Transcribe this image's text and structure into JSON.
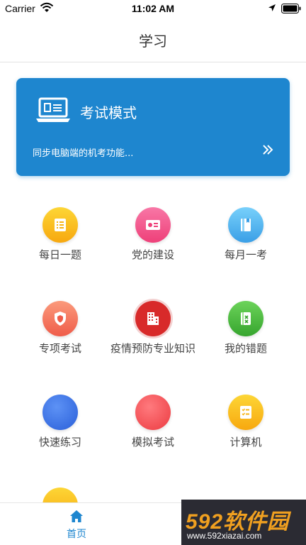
{
  "status_bar": {
    "carrier": "Carrier",
    "time": "11:02 AM"
  },
  "nav": {
    "title": "学习"
  },
  "exam_card": {
    "title": "考试模式",
    "subtitle": "同步电脑端的机考功能...",
    "color": "#1e86cf",
    "icon": "laptop-icon"
  },
  "grid": {
    "items": [
      {
        "label": "每日一题",
        "icon": "list-icon",
        "color": "#f9c21a"
      },
      {
        "label": "党的建设",
        "icon": "party-flag-icon",
        "color": "#f45b8e"
      },
      {
        "label": "每月一考",
        "icon": "book-icon",
        "color": "#4fb7ef"
      },
      {
        "label": "专项考试",
        "icon": "shield-icon",
        "color": "#f47a5e"
      },
      {
        "label": "疫情预防专业知识",
        "icon": "building-icon",
        "color": "#d82a2a"
      },
      {
        "label": "我的错题",
        "icon": "notebook-icon",
        "color": "#4cbb3f"
      },
      {
        "label": "快速练习",
        "icon": "blue-circle-icon",
        "color": "#2f6fe6"
      },
      {
        "label": "模拟考试",
        "icon": "red-circle-icon",
        "color": "#f0444a"
      },
      {
        "label": "计算机",
        "icon": "checklist-icon",
        "color": "#f9b81a"
      }
    ]
  },
  "tab_bar": {
    "home_label": "首页",
    "accent": "#1e86cf"
  },
  "watermark": {
    "logo": "592软件园",
    "url": "www.592xiazai.com"
  }
}
